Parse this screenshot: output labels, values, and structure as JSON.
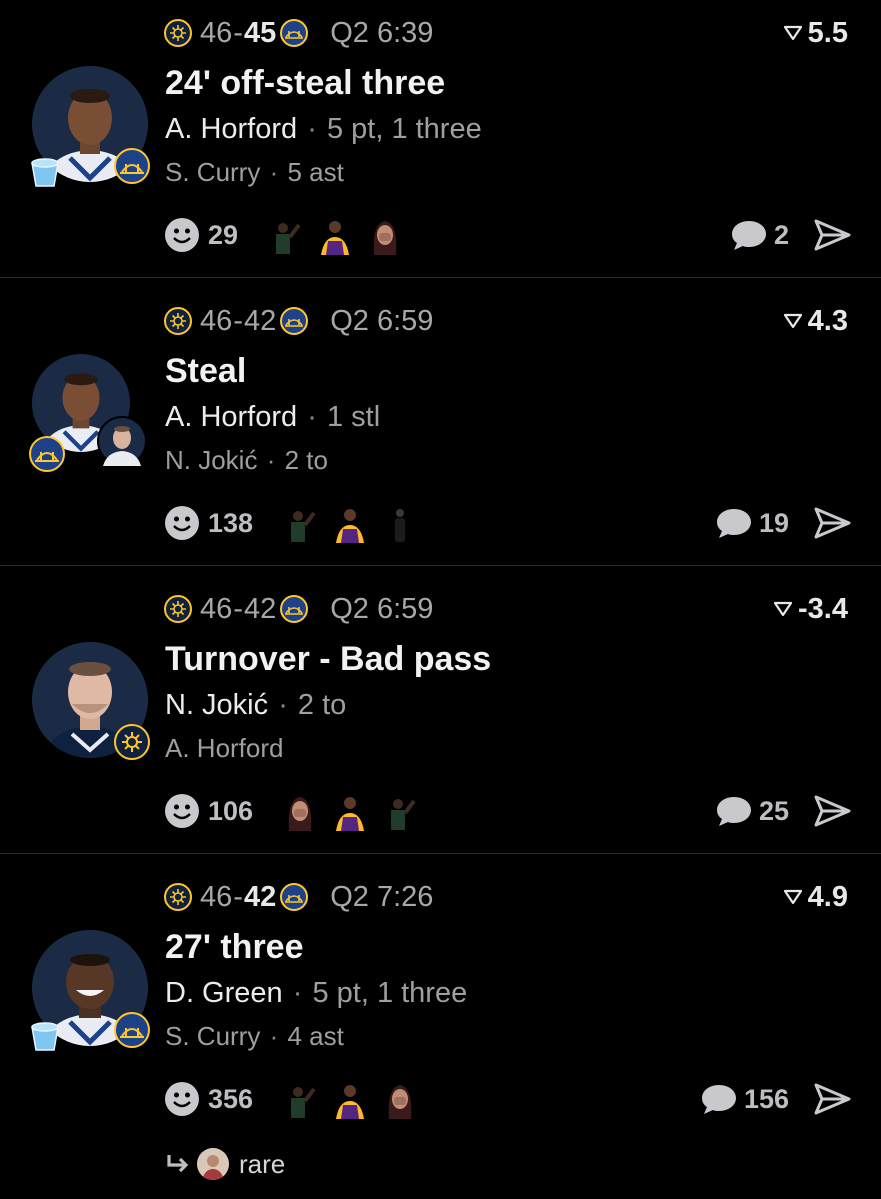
{
  "plays": [
    {
      "score_home": "46",
      "score_away": "45",
      "bold_side": "away",
      "clock": "Q2 6:39",
      "odds": "5.5",
      "title": "24' off-steal three",
      "player": "A. Horford",
      "player_stat": "5 pt, 1 three",
      "assist_player": "S. Curry",
      "assist_stat": "5 ast",
      "reactions": "29",
      "comments": "2"
    },
    {
      "score_home": "46",
      "score_away": "42",
      "bold_side": "none",
      "clock": "Q2 6:59",
      "odds": "4.3",
      "title": "Steal",
      "player": "A. Horford",
      "player_stat": "1 stl",
      "assist_player": "N. Jokić",
      "assist_stat": "2 to",
      "reactions": "138",
      "comments": "19"
    },
    {
      "score_home": "46",
      "score_away": "42",
      "bold_side": "none",
      "clock": "Q2 6:59",
      "odds": "-3.4",
      "title": "Turnover - Bad pass",
      "player": "N. Jokić",
      "player_stat": "2 to",
      "assist_player": "A. Horford",
      "assist_stat": "",
      "reactions": "106",
      "comments": "25"
    },
    {
      "score_home": "46",
      "score_away": "42",
      "bold_side": "away",
      "clock": "Q2 7:26",
      "odds": "4.9",
      "title": "27' three",
      "player": "D. Green",
      "player_stat": "5 pt, 1 three",
      "assist_player": "S. Curry",
      "assist_stat": "4 ast",
      "reactions": "356",
      "comments": "156"
    }
  ],
  "reply": {
    "text": "rare"
  },
  "colors": {
    "background": "#000000",
    "nuggets_navy": "#0e2240",
    "nuggets_gold": "#fec524",
    "warriors_blue": "#1d428a",
    "warriors_gold": "#ffc72c",
    "bucket_blue": "#7fc6f0"
  },
  "icons": {
    "home_logo": "nuggets-logo-icon",
    "away_logo": "warriors-logo-icon",
    "odds": "filter-funnel-icon",
    "reaction": "smiley-icon",
    "comment": "speech-bubble-icon",
    "share": "send-arrow-icon",
    "reply": "reply-arrow-icon",
    "bucket": "bucket-icon"
  }
}
